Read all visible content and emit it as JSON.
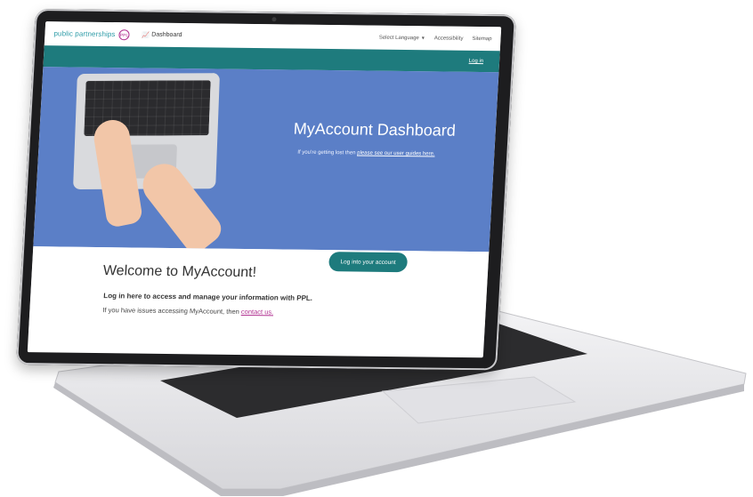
{
  "header": {
    "logo_text": "public partnerships",
    "logo_mark": "PPL",
    "dashboard_icon": "chart-icon",
    "dashboard_label": "Dashboard",
    "select_language": "Select Language",
    "accessibility": "Accessibility",
    "sitemap": "Sitemap"
  },
  "subheader": {
    "login_link": "Log in"
  },
  "hero": {
    "title": "MyAccount Dashboard",
    "subtitle_prefix": "If you're getting lost then ",
    "subtitle_link": "please see our user guides here."
  },
  "content": {
    "welcome": "Welcome to MyAccount!",
    "login_button": "Log into your account",
    "info_bold": "Log in here to access and manage your information with PPL.",
    "info_prefix": "If you have issues accessing MyAccount, then ",
    "info_link": "contact us."
  },
  "colors": {
    "teal": "#1e7b7d",
    "hero_blue": "#5b7fc7",
    "logo_teal": "#2a9aa6",
    "accent_magenta": "#b03090"
  }
}
